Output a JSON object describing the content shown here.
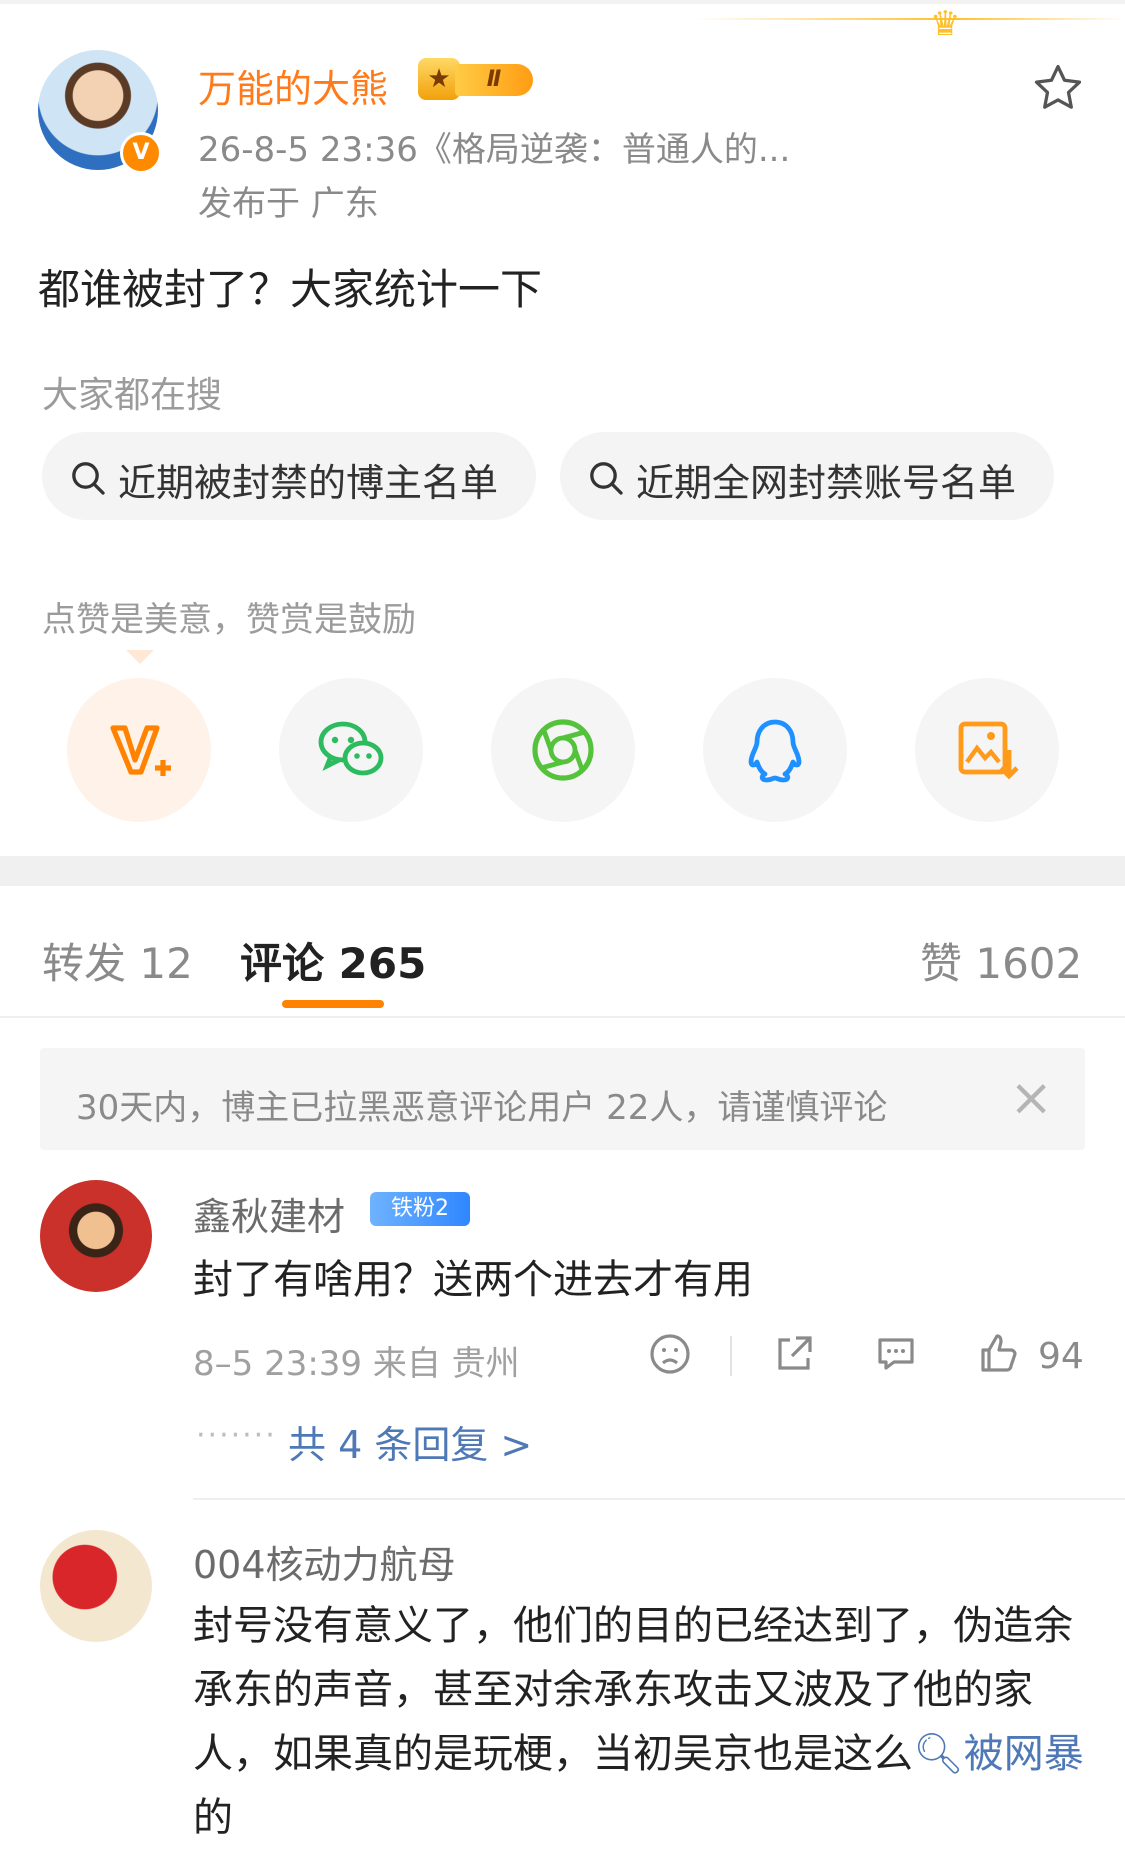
{
  "post": {
    "author": "万能的大熊",
    "vip_level": "Ⅱ",
    "verified_badge": "V",
    "meta": "26-8-5 23:36《格局逆袭：普通人的...",
    "location": "发布于 广东",
    "content": "都谁被封了？大家统计一下"
  },
  "hot_search": {
    "label": "大家都在搜",
    "chips": [
      "近期被封禁的博主名单",
      "近期全网封禁账号名单"
    ]
  },
  "reward": {
    "label": "点赞是美意，赞赏是鼓励",
    "icons": [
      "reward-v-icon",
      "wechat-icon",
      "moments-icon",
      "qq-icon",
      "save-image-icon"
    ]
  },
  "tabs": {
    "repost": "转发 12",
    "comments": "评论 265",
    "likes": "赞 1602"
  },
  "notice": {
    "text": "30天内，博主已拉黑恶意评论用户 22人，请谨慎评论",
    "close": "×"
  },
  "comments": [
    {
      "name": "鑫秋建材",
      "badge": "铁粉2",
      "text": "封了有啥用？送两个进去才有用",
      "meta": "8–5 23:39 来自 贵州",
      "likes": "94",
      "replies_dots": "·······",
      "replies": "共 4 条回复 >"
    },
    {
      "name": "004核动力航母",
      "text_before_link": "封号没有意义了，他们的目的已经达到了，伪造余承东的声音，甚至对余承东攻击又波及了他的家人，如果真的是玩梗，当初吴京也是这么",
      "link": "被网暴",
      "text_after_link": "的"
    }
  ],
  "colors": {
    "accent": "#ff8200",
    "username": "#ff7a1a",
    "link": "#4e78b6"
  }
}
